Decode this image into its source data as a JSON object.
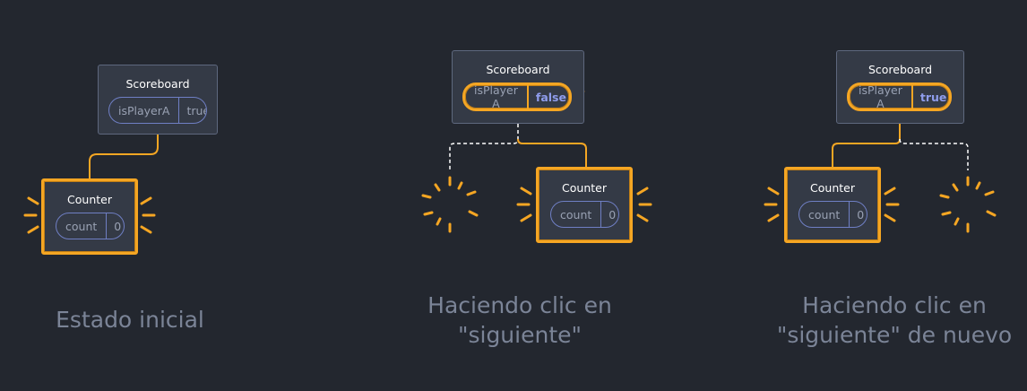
{
  "stages": [
    {
      "caption": "Estado inicial",
      "scoreboard": {
        "title": "Scoreboard",
        "key": "isPlayerA",
        "value": "true"
      },
      "counter": {
        "title": "Counter",
        "key": "count",
        "value": "0"
      }
    },
    {
      "caption": "Haciendo clic en \"siguiente\"",
      "scoreboard": {
        "title": "Scoreboard",
        "key": "isPlayer A",
        "value": "false"
      },
      "counter": {
        "title": "Counter",
        "key": "count",
        "value": "0"
      }
    },
    {
      "caption": "Haciendo clic en \"siguiente\" de nuevo",
      "scoreboard": {
        "title": "Scoreboard",
        "key": "isPlayer A",
        "value": "true"
      },
      "counter": {
        "title": "Counter",
        "key": "count",
        "value": "0"
      }
    }
  ],
  "colors": {
    "background": "#23272f",
    "highlight": "#f5a623",
    "state_border": "#6f7fc4",
    "caption": "#7b8497"
  }
}
